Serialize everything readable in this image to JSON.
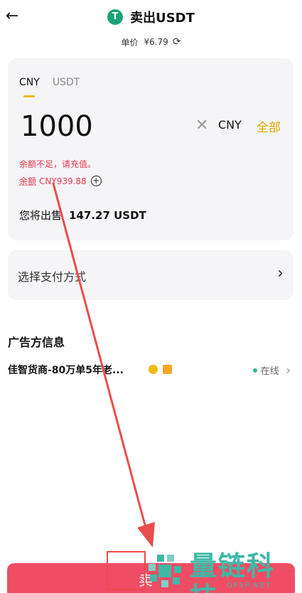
{
  "header": {
    "back_icon": "arrow-left-icon",
    "coin_icon": "tether-icon",
    "coin_letter": "T",
    "title": "卖出USDT"
  },
  "price": {
    "label": "单价",
    "value": "¥6.79",
    "refresh_icon": "refresh-icon"
  },
  "amount_card": {
    "tabs": [
      {
        "label": "CNY",
        "active": true
      },
      {
        "label": "USDT",
        "active": false
      }
    ],
    "amount": "1000",
    "currency": "CNY",
    "all_label": "全部",
    "error_text": "余额不足，请充值。",
    "balance_label": "余额",
    "balance_value": "CNY939.88",
    "receive_label": "您将出售",
    "receive_value": "147.27 USDT"
  },
  "payment": {
    "label": "选择支付方式"
  },
  "advertiser": {
    "section_title": "广告方信息",
    "name": "佳智货商-80万单5年老...",
    "status": "在线"
  },
  "sell_button": {
    "label": "卖"
  },
  "watermark": {
    "cn": "量链科技",
    "en": "QFSP.NET"
  },
  "colors": {
    "accent": "#f0b90b",
    "sell": "#ef4d64",
    "error": "#e5394b",
    "online": "#2ebd85",
    "annotation": "#e84d4d",
    "watermark": "#3fb8a7"
  }
}
